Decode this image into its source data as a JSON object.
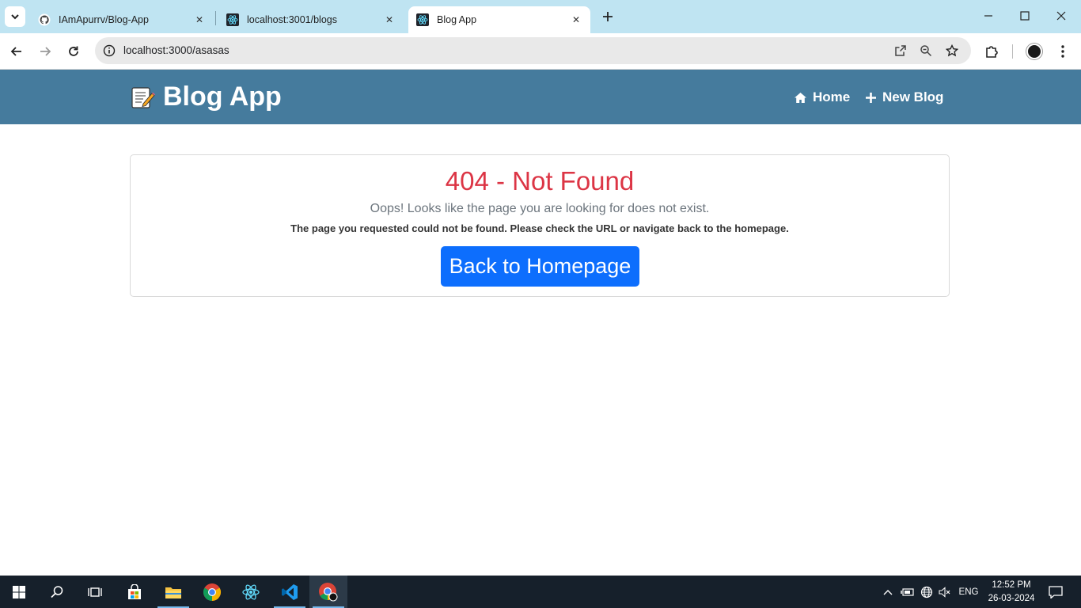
{
  "browser": {
    "tabs": [
      {
        "title": "IAmApurrv/Blog-App",
        "icon": "github-icon",
        "active": false
      },
      {
        "title": "localhost:3001/blogs",
        "icon": "react-icon",
        "active": false
      },
      {
        "title": "Blog App",
        "icon": "react-icon",
        "active": true
      }
    ],
    "url": "localhost:3000/asasas"
  },
  "app": {
    "brand": "Blog App",
    "brand_icon": "memo-icon",
    "nav": [
      {
        "label": "Home",
        "icon": "home-icon"
      },
      {
        "label": "New Blog",
        "icon": "plus-icon"
      }
    ]
  },
  "error_page": {
    "title": "404 - Not Found",
    "lead": "Oops! Looks like the page you are looking for does not exist.",
    "description": "The page you requested could not be found. Please check the URL or navigate back to the homepage.",
    "button_label": "Back to Homepage"
  },
  "taskbar": {
    "apps": [
      "start-icon",
      "search-icon",
      "task-view-icon",
      "store-icon",
      "file-explorer-icon",
      "chrome-icon",
      "react-devtools-icon",
      "vscode-icon",
      "chrome-profile-icon"
    ],
    "language": "ENG",
    "time": "12:52 PM",
    "date": "26-03-2024"
  },
  "colors": {
    "navbar": "#457b9d",
    "error_title": "#dc3545",
    "primary_button": "#0d6efd",
    "tabstrip": "#bfe4f2"
  }
}
